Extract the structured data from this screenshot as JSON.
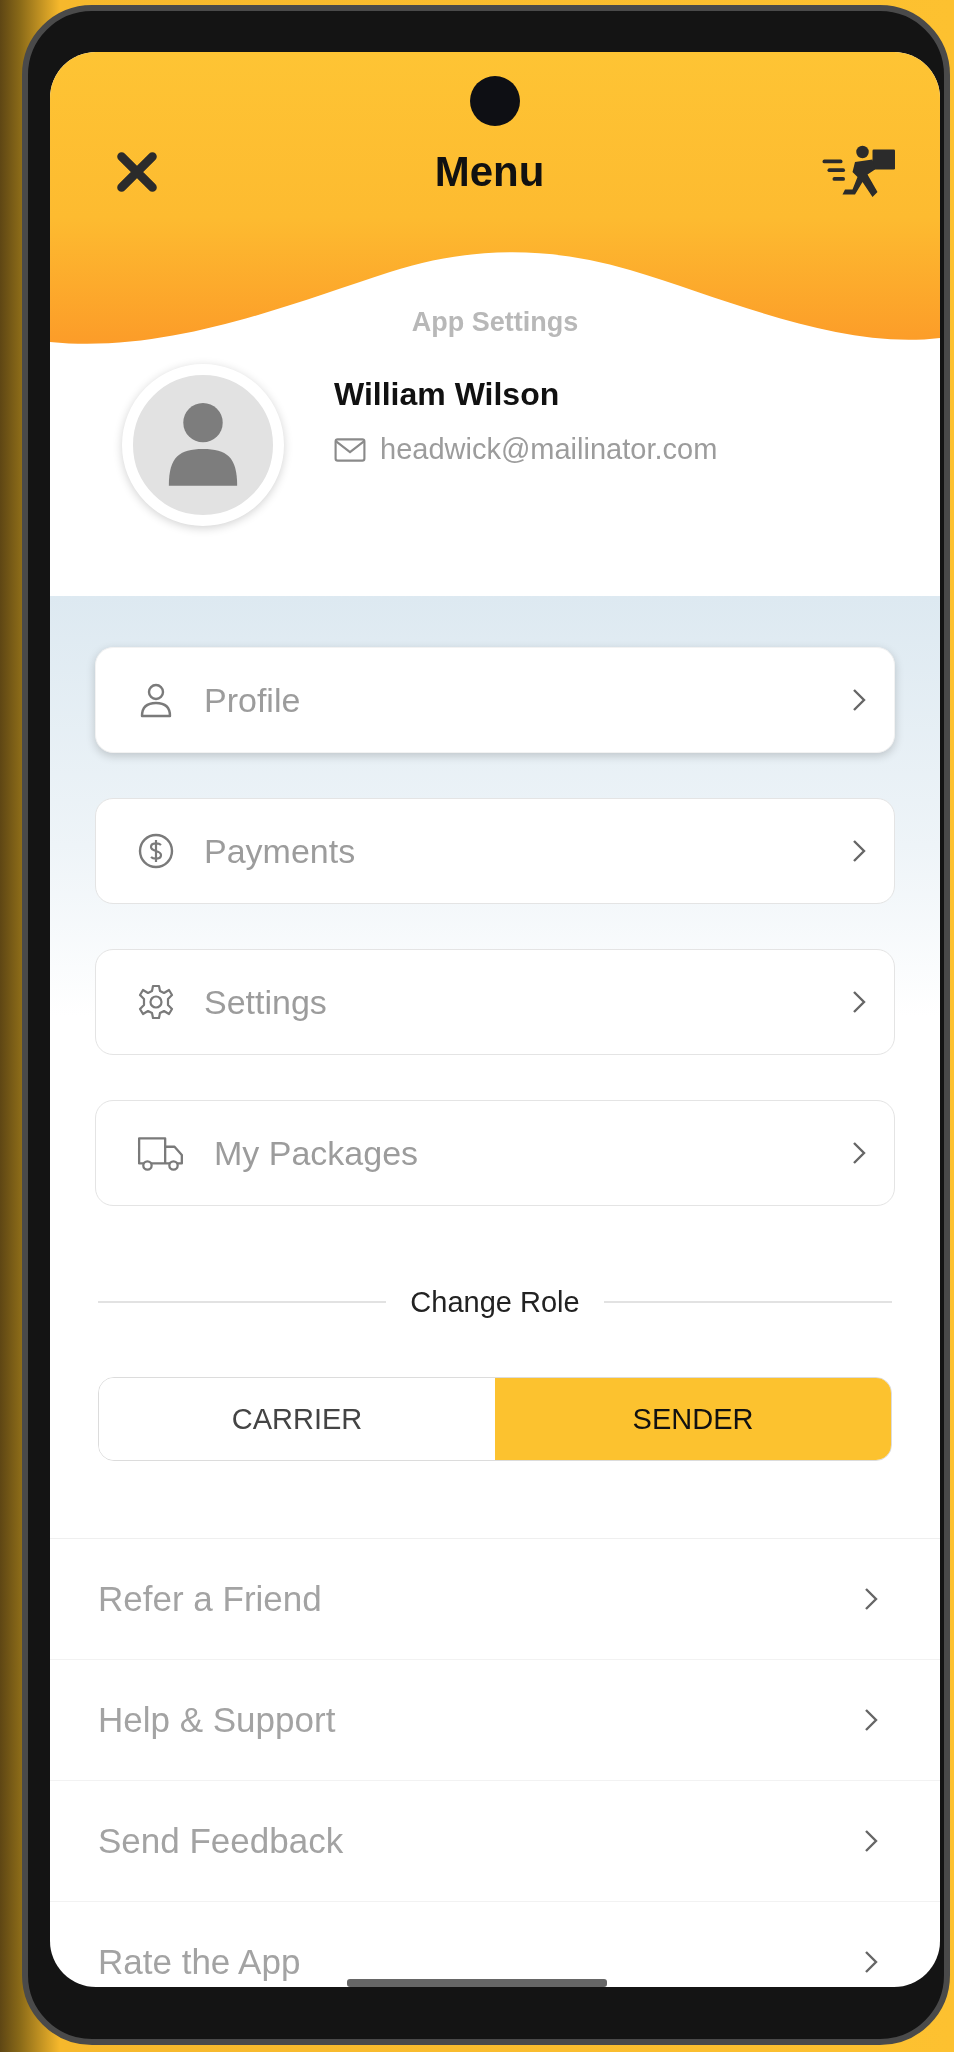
{
  "header": {
    "title": "Menu",
    "subtitle": "App Settings"
  },
  "profile": {
    "name": "William Wilson",
    "email": "headwick@mailinator.com"
  },
  "menu_cards": [
    {
      "label": "Profile",
      "selected": true
    },
    {
      "label": "Payments",
      "selected": false
    },
    {
      "label": "Settings",
      "selected": false
    },
    {
      "label": "My Packages",
      "selected": false
    }
  ],
  "role": {
    "label": "Change Role",
    "options": [
      {
        "label": "CARRIER",
        "selected": false
      },
      {
        "label": "SENDER",
        "selected": true
      }
    ]
  },
  "links": [
    {
      "label": "Refer a Friend"
    },
    {
      "label": "Help & Support"
    },
    {
      "label": "Send Feedback"
    },
    {
      "label": "Rate the App"
    }
  ]
}
